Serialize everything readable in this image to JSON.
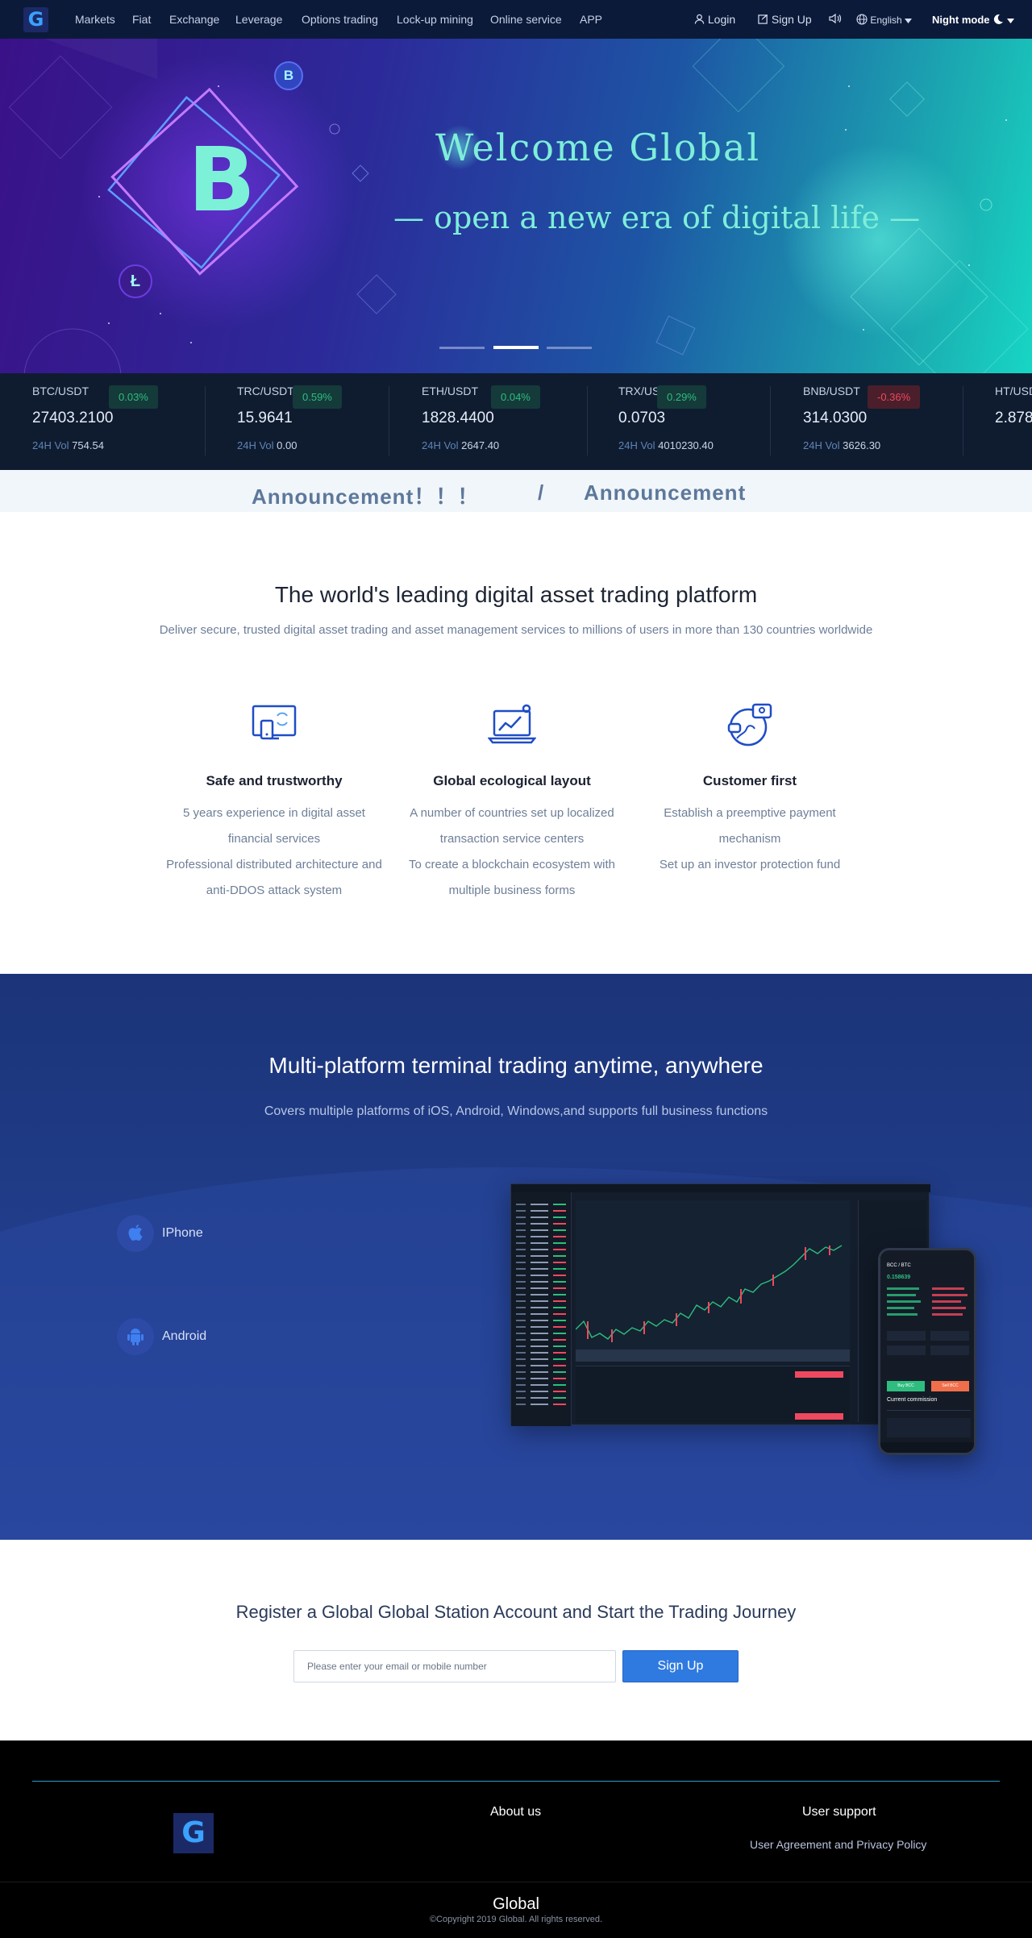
{
  "nav": {
    "logo_letter": "G",
    "items": [
      "Markets",
      "Fiat",
      "Exchange",
      "Leverage",
      "Options trading",
      "Lock-up mining",
      "Online service",
      "APP"
    ],
    "login": "Login",
    "signup": "Sign Up",
    "language": "English",
    "night_mode": "Night mode"
  },
  "hero": {
    "title": "Welcome  Global",
    "subtitle": "— open a new era of digital life —",
    "coin_symbol": "B",
    "small_coin_b": "B",
    "small_coin_l": "Ł",
    "slides": 3,
    "active_slide": 2
  },
  "ticker": [
    {
      "pair": "BTC/USDT",
      "change": "0.03%",
      "price": "27403.2100",
      "vol_label": "24H Vol",
      "vol": "754.54",
      "direction": "up"
    },
    {
      "pair": "TRC/USDT",
      "change": "0.59%",
      "price": "15.9641",
      "vol_label": "24H Vol",
      "vol": "0.00",
      "direction": "up"
    },
    {
      "pair": "ETH/USDT",
      "change": "0.04%",
      "price": "1828.4400",
      "vol_label": "24H Vol",
      "vol": "2647.40",
      "direction": "up"
    },
    {
      "pair": "TRX/USDT",
      "change": "0.29%",
      "price": "0.0703",
      "vol_label": "24H Vol",
      "vol": "4010230.40",
      "direction": "up"
    },
    {
      "pair": "BNB/USDT",
      "change": "-0.36%",
      "price": "314.0300",
      "vol_label": "24H Vol",
      "vol": "3626.30",
      "direction": "down"
    },
    {
      "pair": "HT/USDT",
      "change": "",
      "price": "2.878",
      "vol_label": "24H Vol",
      "vol": "",
      "direction": "up"
    }
  ],
  "announcement": {
    "left": "Announcement！！！",
    "separator": "/",
    "right": "Announcement"
  },
  "features": {
    "title": "The world's leading digital asset trading platform",
    "desc": "Deliver secure, trusted digital asset trading and asset management services to millions of users in more than 130 countries worldwide",
    "items": [
      {
        "title": "Safe and trustworthy",
        "lines": [
          "5 years experience in digital asset",
          "financial services",
          "Professional distributed architecture and",
          "anti-DDOS attack system"
        ],
        "icon": "shield-device-icon"
      },
      {
        "title": "Global ecological layout",
        "lines": [
          "A number of countries set up localized",
          "transaction service centers",
          "To create a blockchain ecosystem with",
          "multiple business forms"
        ],
        "icon": "laptop-chart-icon"
      },
      {
        "title": "Customer first",
        "lines": [
          "Establish a preemptive payment",
          "mechanism",
          "Set up an investor protection fund"
        ],
        "icon": "globe-support-icon"
      }
    ]
  },
  "platform": {
    "title": "Multi-platform terminal trading anytime, anywhere",
    "desc": "Covers multiple platforms of iOS, Android, Windows,and supports full business functions",
    "items": [
      {
        "label": "IPhone",
        "icon": "apple-icon"
      },
      {
        "label": "Android",
        "icon": "android-icon"
      }
    ],
    "mockup_pair": "BCC / BTC",
    "mockup_price": "0.158639",
    "mockup_buy": "Buy BCC",
    "mockup_sell": "Sell BCC",
    "mockup_commission": "Current commission"
  },
  "register": {
    "title": "Register a Global Global Station Account and Start the Trading Journey",
    "placeholder": "Please enter your email or mobile number",
    "button": "Sign Up"
  },
  "footer": {
    "about": "About us",
    "support": "User support",
    "support_link": "User Agreement and Privacy Policy",
    "brand": "Global",
    "copyright": "©Copyright 2019 Global. All rights reserved."
  },
  "colors": {
    "nav_bg": "#0c1a3a",
    "hero_accent": "#7eeed9",
    "up": "#2ebd7e",
    "down": "#f0485e",
    "platform_bg": "#1b3479",
    "primary": "#2f7ae0"
  }
}
